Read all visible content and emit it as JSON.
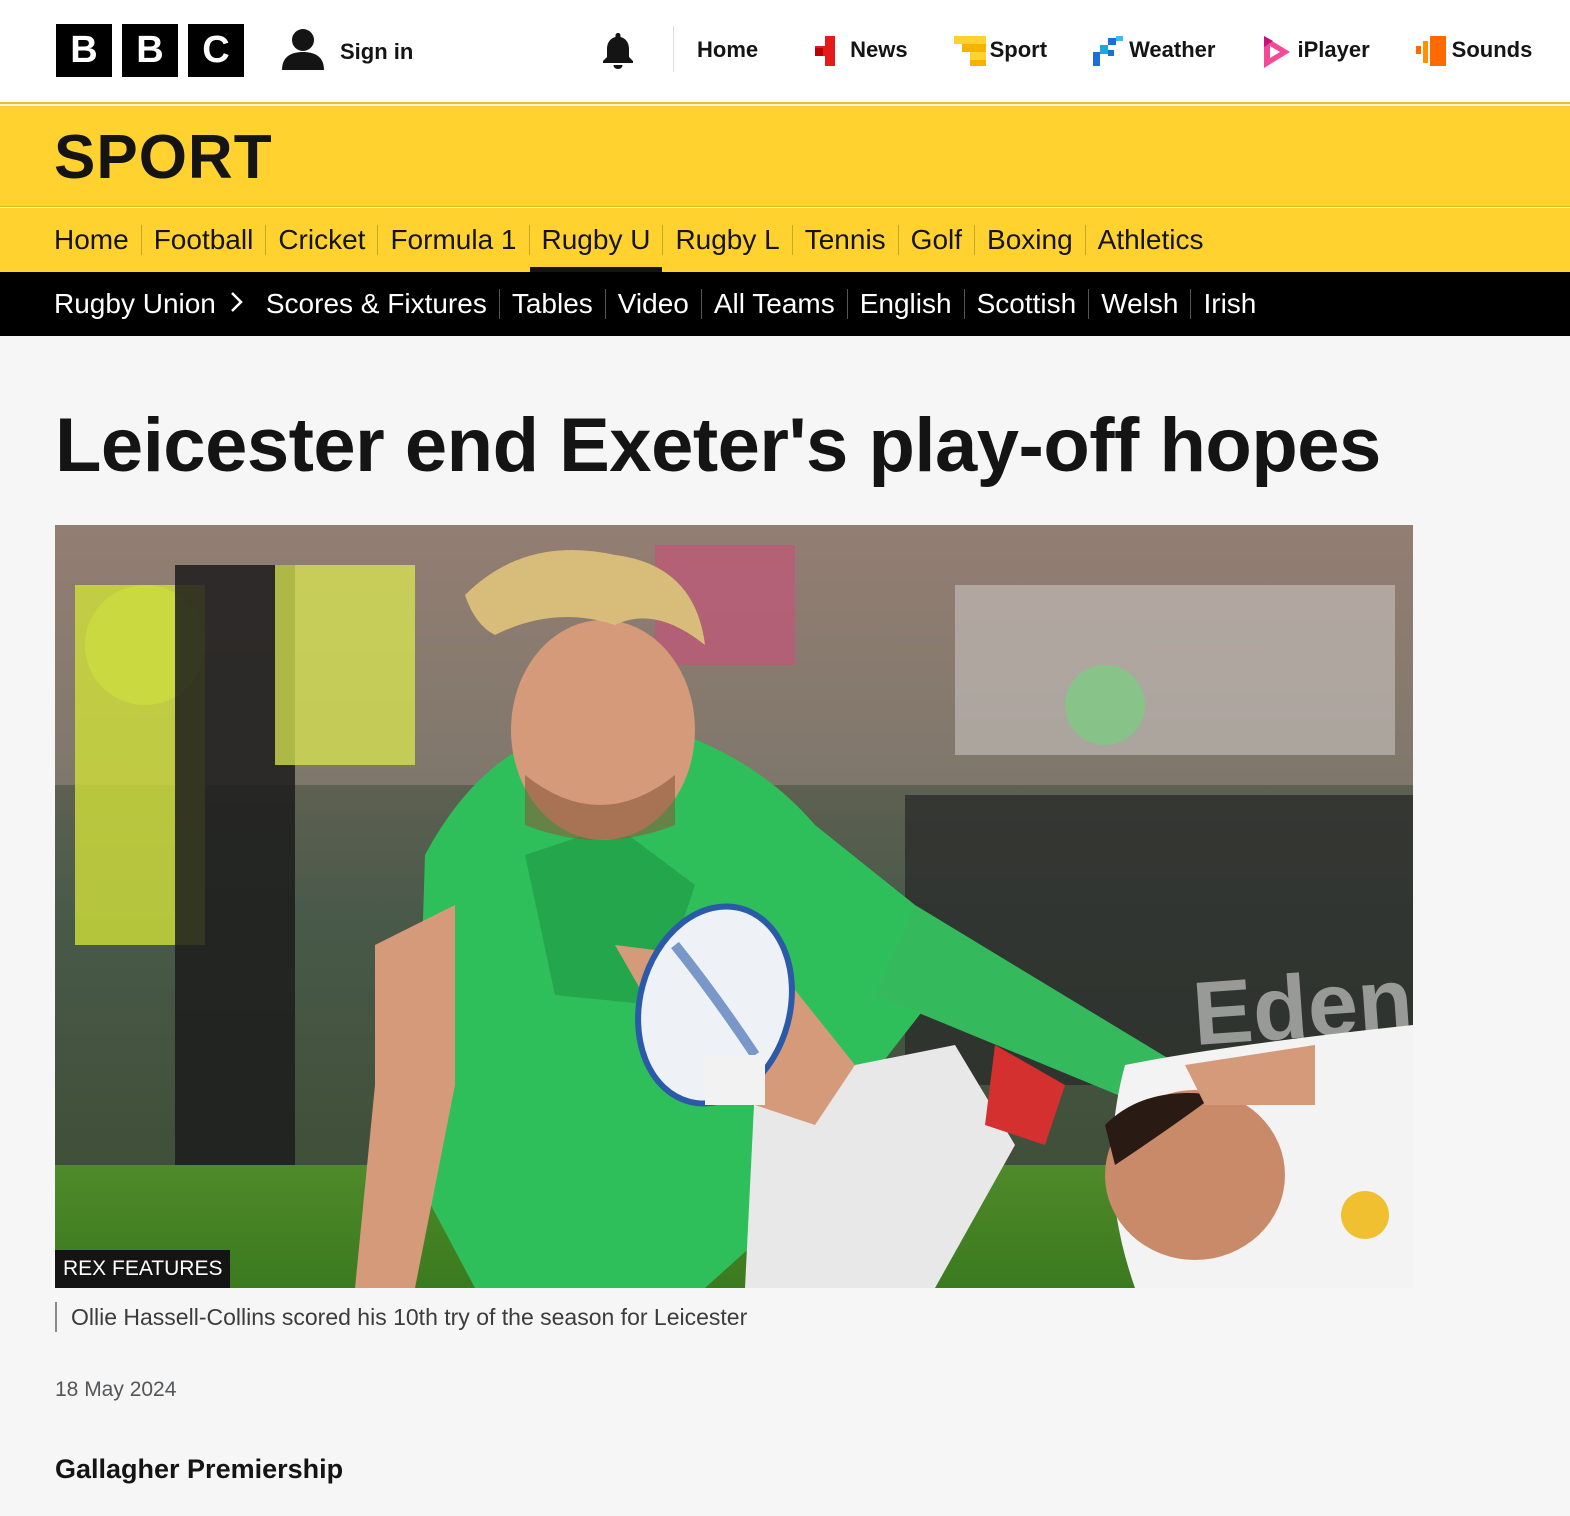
{
  "brand": {
    "logo_letters": [
      "B",
      "B",
      "C"
    ],
    "accent_yellow": "#ffd230",
    "text_dark": "#141414"
  },
  "topbar": {
    "signin_label": "Sign in",
    "nav": [
      {
        "label": "Home",
        "icon": "none"
      },
      {
        "label": "News",
        "icon": "news-icon"
      },
      {
        "label": "Sport",
        "icon": "sport-icon"
      },
      {
        "label": "Weather",
        "icon": "weather-icon"
      },
      {
        "label": "iPlayer",
        "icon": "iplayer-icon"
      },
      {
        "label": "Sounds",
        "icon": "sounds-icon"
      }
    ]
  },
  "section": {
    "title": "SPORT"
  },
  "sport_nav": {
    "items": [
      "Home",
      "Football",
      "Cricket",
      "Formula 1",
      "Rugby U",
      "Rugby L",
      "Tennis",
      "Golf",
      "Boxing",
      "Athletics"
    ],
    "active": "Rugby U"
  },
  "sub_nav": {
    "current": "Rugby Union",
    "items": [
      "Scores & Fixtures",
      "Tables",
      "Video",
      "All Teams",
      "English",
      "Scottish",
      "Welsh",
      "Irish"
    ]
  },
  "article": {
    "headline": "Leicester end Exeter's play-off hopes",
    "image_credit": "REX FEATURES",
    "image_caption": "Ollie Hassell-Collins scored his 10th try of the season for Leicester",
    "date": "18 May 2024",
    "competition": "Gallagher Premiership"
  }
}
